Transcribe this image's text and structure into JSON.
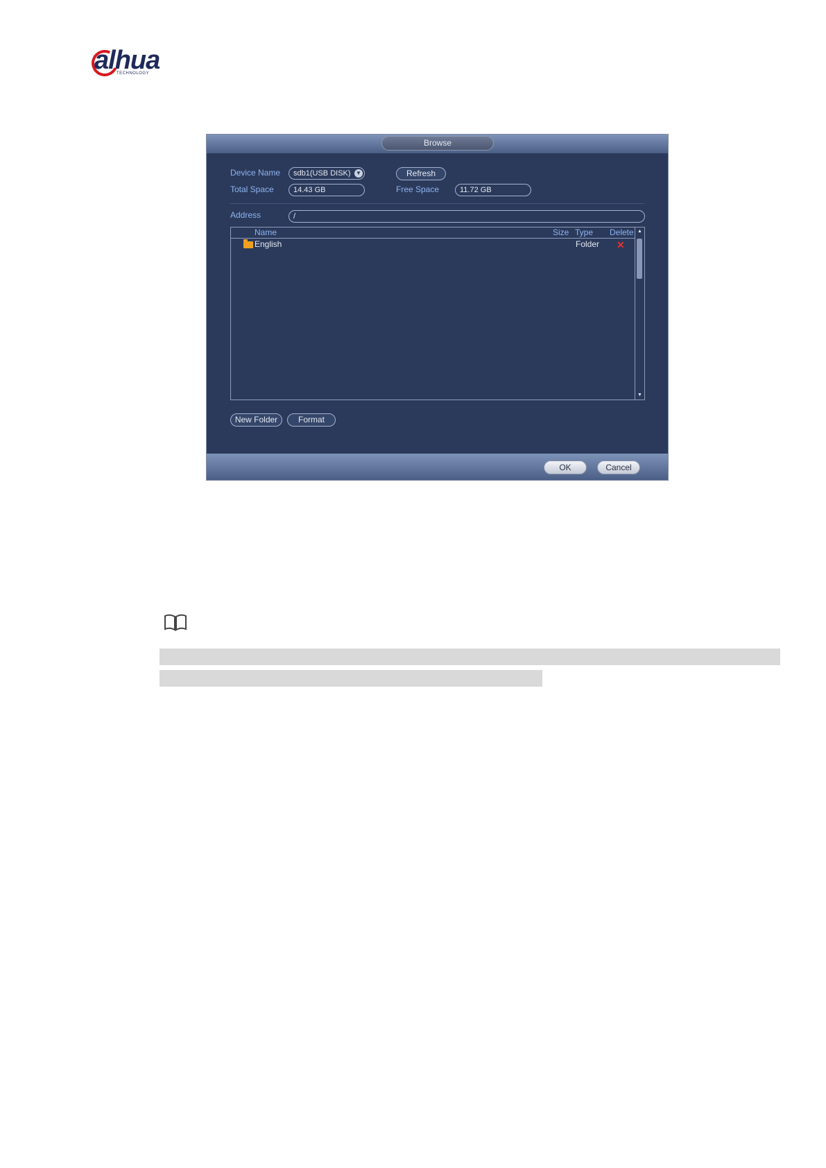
{
  "logo": {
    "brand": "alhua",
    "sub": "TECHNOLOGY"
  },
  "dialog": {
    "title": "Browse",
    "device_name_label": "Device Name",
    "device_name_value": "sdb1(USB DISK)",
    "refresh_label": "Refresh",
    "total_space_label": "Total Space",
    "total_space_value": "14.43 GB",
    "free_space_label": "Free Space",
    "free_space_value": "11.72 GB",
    "address_label": "Address",
    "address_value": "/",
    "columns": {
      "name": "Name",
      "size": "Size",
      "type": "Type",
      "delete": "Delete"
    },
    "rows": [
      {
        "name": "English",
        "size": "",
        "type": "Folder"
      }
    ],
    "new_folder_label": "New Folder",
    "format_label": "Format",
    "ok_label": "OK",
    "cancel_label": "Cancel"
  }
}
